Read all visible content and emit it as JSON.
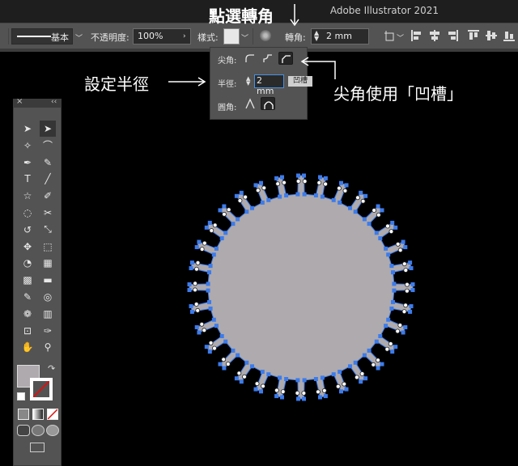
{
  "window": {
    "app_title": "Adobe Illustrator 2021"
  },
  "control_bar": {
    "stroke_style": "基本",
    "opacity_label": "不透明度:",
    "opacity_value": "100%",
    "style_label": "樣式:",
    "corner_label": "轉角:",
    "corner_value": "2 mm"
  },
  "corner_popover": {
    "corner_label": "尖角:",
    "radius_label": "半徑:",
    "radius_value": "2 mm",
    "radius_tooltip": "凹槽",
    "rounding_label": "圓角:"
  },
  "annotations": {
    "click_corner": "點選轉角",
    "set_radius": "設定半徑",
    "chamfer_note": "尖角使用「凹槽」"
  },
  "tools_panel": {
    "close": "×",
    "collapse": "‹‹",
    "tools": [
      "selection-tool",
      "direct-selection-tool",
      "magic-wand-tool",
      "lasso-tool",
      "pen-tool",
      "curvature-tool",
      "type-tool",
      "line-segment-tool",
      "star-tool",
      "paintbrush-tool",
      "shaper-tool",
      "scissors-tool",
      "rotate-tool",
      "scale-tool",
      "puppet-warp-tool",
      "free-transform-tool",
      "shape-builder-tool",
      "perspective-grid-tool",
      "mesh-tool",
      "gradient-tool",
      "eyedropper-tool",
      "blend-tool",
      "symbol-sprayer-tool",
      "column-graph-tool",
      "artboard-tool",
      "slice-tool",
      "hand-tool",
      "zoom-tool"
    ]
  },
  "colors": {
    "canvas": "#000000",
    "panel": "#535353",
    "shape_fill": "#aeaaad",
    "anchor_blue": "#3d7bea"
  }
}
